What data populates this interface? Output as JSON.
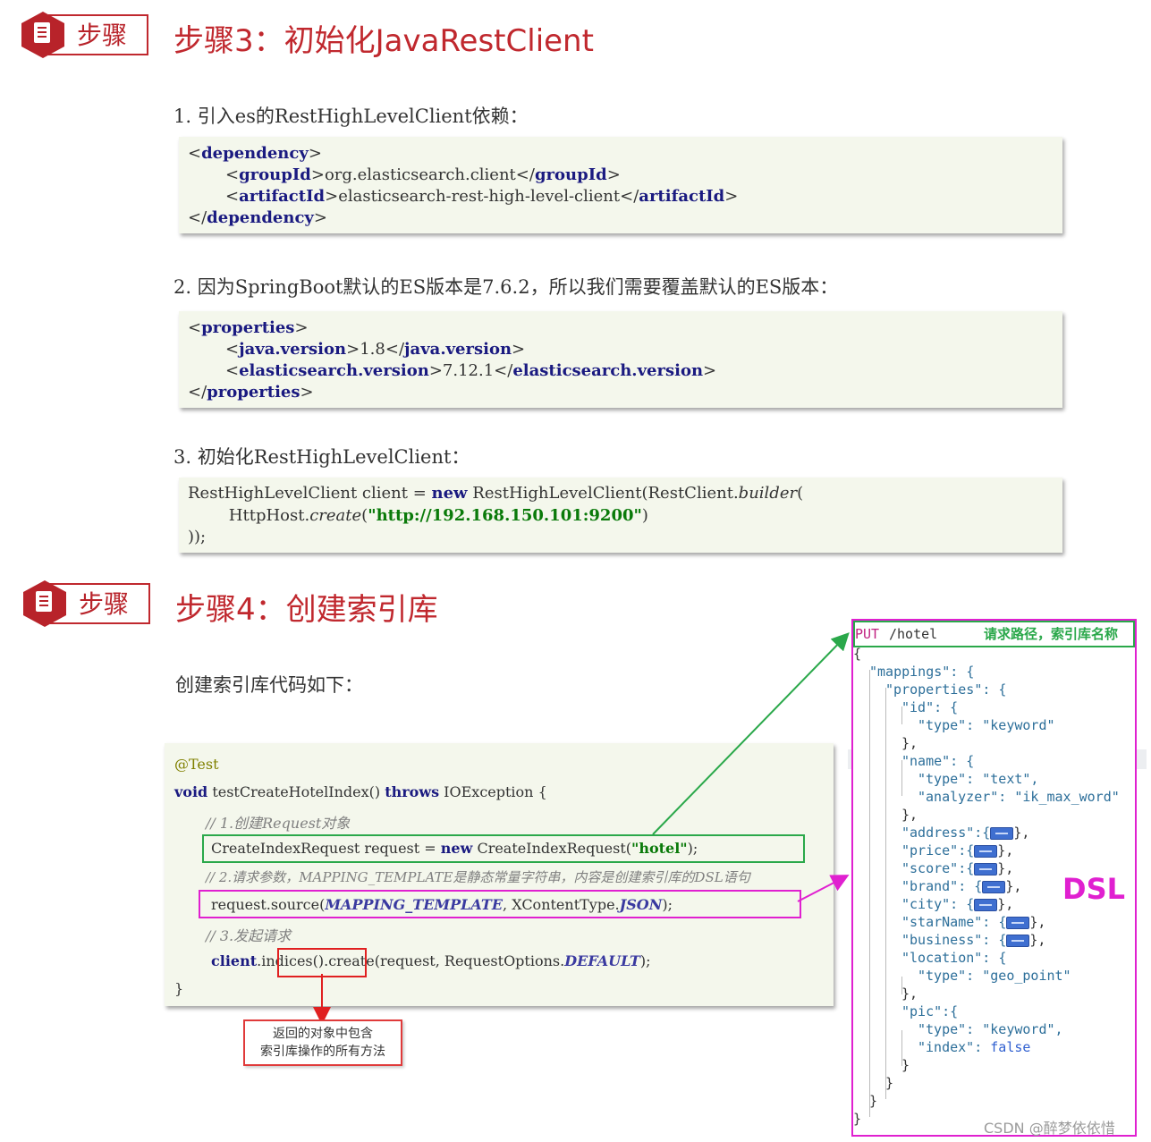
{
  "step3": {
    "badge": "步骤",
    "title": "步骤3：初始化JavaRestClient",
    "item1": "1.  引入es的RestHighLevelClient依赖：",
    "code1": {
      "l1_tag": "dependency",
      "l2_tag": "groupId",
      "l2_val": "org.elasticsearch.client",
      "l3_tag": "artifactId",
      "l3_val": "elasticsearch-rest-high-level-client",
      "l4_tag": "dependency"
    },
    "item2": "2.  因为SpringBoot默认的ES版本是7.6.2，所以我们需要覆盖默认的ES版本：",
    "code2": {
      "l1_tag": "properties",
      "l2_tag": "java.version",
      "l2_val": "1.8",
      "l3_tag": "elasticsearch.version",
      "l3_val": "7.12.1",
      "l4_tag": "properties"
    },
    "item3": "3.  初始化RestHighLevelClient：",
    "code3": {
      "l1a": "RestHighLevelClient client = ",
      "l1_new": "new",
      "l1b": " RestHighLevelClient(RestClient.",
      "l1_builder": "builder",
      "l1c": "(",
      "l2a": "        HttpHost.",
      "l2_create": "create",
      "l2b": "(",
      "l2_str": "\"http://192.168.150.101:9200\"",
      "l2c": ")",
      "l3": "));"
    }
  },
  "step4": {
    "badge": "步骤",
    "title": "步骤4：创建索引库",
    "desc": "创建索引库代码如下：",
    "java": {
      "annotation": "@Test",
      "sig_void": "void",
      "sig_name": " testCreateHotelIndex() ",
      "sig_throws": "throws",
      "sig_rest": " IOException {",
      "c1": "// 1.创建Request对象",
      "l1a": "CreateIndexRequest request = ",
      "l1_new": "new",
      "l1b": " CreateIndexRequest(",
      "l1_str": "\"hotel\"",
      "l1c": ");",
      "c2": "// 2.请求参数，MAPPING_TEMPLATE是静态常量字符串，内容是创建索引库的DSL语句",
      "l2a": "request.source(",
      "l2_const": "MAPPING_TEMPLATE",
      "l2b": ", XContentType.",
      "l2_json": "JSON",
      "l2c": ");",
      "c3": "// 3.发起请求",
      "l3_client": "client",
      "l3a": ".indices().create(request, RequestOptions.",
      "l3_default": "DEFAULT",
      "l3b": ");",
      "close": "}"
    },
    "note_line1": "返回的对象中包含",
    "note_line2": "索引库操作的所有方法",
    "dsl": {
      "method": "PUT",
      "path": "/hotel",
      "tip": "请求路径，索引库名称",
      "label": "DSL",
      "lines": {
        "open": "{",
        "mappings": "\"mappings\": {",
        "properties": "\"properties\": {",
        "id": "\"id\": {",
        "id_type": "\"type\": \"keyword\"",
        "close1": "},",
        "name": "\"name\": {",
        "name_type": "\"type\": \"text\",",
        "name_analyzer": "\"analyzer\": \"ik_max_word\"",
        "close2": "},",
        "address": "\"address\":{",
        "price": "\"price\":{",
        "score": "\"score\":{",
        "brand": "\"brand\": {",
        "city": "\"city\": {",
        "starName": "\"starName\": {",
        "business": "\"business\": {",
        "location": "\"location\": {",
        "loc_type": "\"type\": \"geo_point\"",
        "close3": "},",
        "pic": "\"pic\":{",
        "pic_type": "\"type\": \"keyword\",",
        "pic_index": "\"index\": ",
        "pic_false": "false",
        "close_pic": "}",
        "close_props": "}",
        "close_map": "}",
        "close_root": "}",
        "tail_comma": "},"
      }
    }
  },
  "watermark": "CSDN @醉梦依依惜",
  "colors": {
    "red": "#c0282e",
    "green": "#2aa84a",
    "magenta": "#e020d0"
  }
}
